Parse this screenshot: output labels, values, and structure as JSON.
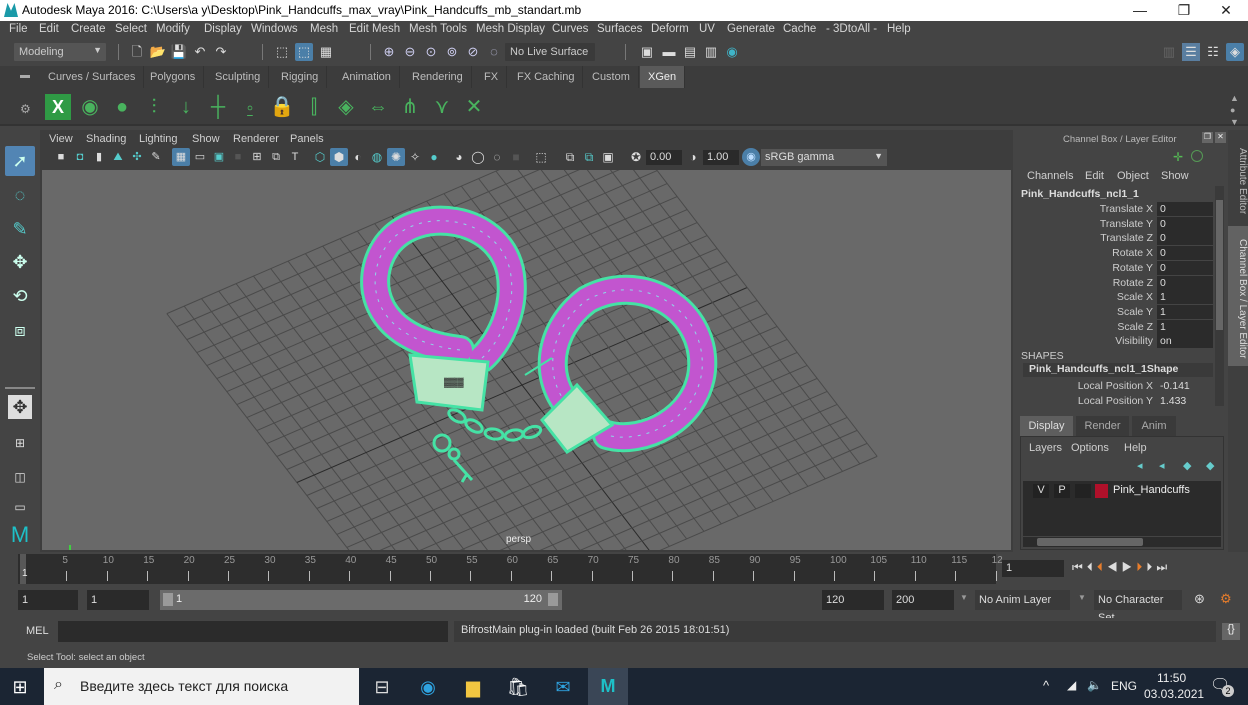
{
  "window": {
    "title": "Autodesk Maya 2016: C:\\Users\\a y\\Desktop\\Pink_Handcuffs_max_vray\\Pink_Handcuffs_mb_standart.mb",
    "minimize": "—",
    "maximize": "❐",
    "close": "✕"
  },
  "menubar": [
    "File",
    "Edit",
    "Create",
    "Select",
    "Modify",
    "Display",
    "Windows",
    "Mesh",
    "Edit Mesh",
    "Mesh Tools",
    "Mesh Display",
    "Curves",
    "Surfaces",
    "Deform",
    "UV",
    "Generate",
    "Cache",
    "- 3DtoAll -",
    "Help"
  ],
  "status_line": {
    "menu_set": "Modeling",
    "live_surface": "No Live Surface"
  },
  "shelf": {
    "tabs": [
      "Curves / Surfaces",
      "Polygons",
      "Sculpting",
      "Rigging",
      "Animation",
      "Rendering",
      "FX",
      "FX Caching",
      "Custom",
      "XGen"
    ],
    "active_tab": "XGen"
  },
  "panel": {
    "menus": [
      "View",
      "Shading",
      "Lighting",
      "Show",
      "Renderer",
      "Panels"
    ],
    "exposure": "0.00",
    "gamma": "1.00",
    "color_space": "sRGB gamma",
    "camera_label": "persp"
  },
  "channel_box": {
    "title": "Channel Box / Layer Editor",
    "menus": [
      "Channels",
      "Edit",
      "Object",
      "Show"
    ],
    "object_name": "Pink_Handcuffs_ncl1_1",
    "channels": [
      {
        "label": "Translate X",
        "value": "0"
      },
      {
        "label": "Translate Y",
        "value": "0"
      },
      {
        "label": "Translate Z",
        "value": "0"
      },
      {
        "label": "Rotate X",
        "value": "0"
      },
      {
        "label": "Rotate Y",
        "value": "0"
      },
      {
        "label": "Rotate Z",
        "value": "0"
      },
      {
        "label": "Scale X",
        "value": "1"
      },
      {
        "label": "Scale Y",
        "value": "1"
      },
      {
        "label": "Scale Z",
        "value": "1"
      },
      {
        "label": "Visibility",
        "value": "on"
      }
    ],
    "shapes_header": "SHAPES",
    "shape_name": "Pink_Handcuffs_ncl1_1Shape",
    "shape_channels": [
      {
        "label": "Local Position X",
        "value": "-0.141"
      },
      {
        "label": "Local Position Y",
        "value": "1.433"
      }
    ]
  },
  "layer_editor": {
    "tabs": [
      "Display",
      "Render",
      "Anim"
    ],
    "active_tab": "Display",
    "menus": [
      "Layers",
      "Options",
      "Help"
    ],
    "layers": [
      {
        "v": "V",
        "p": "P",
        "name": "Pink_Handcuffs",
        "color": "#b0102a"
      }
    ]
  },
  "side_tabs": [
    "Attribute Editor",
    "Channel Box / Layer Editor"
  ],
  "timeline": {
    "ticks": [
      "5",
      "10",
      "15",
      "20",
      "25",
      "30",
      "35",
      "40",
      "45",
      "50",
      "55",
      "60",
      "65",
      "70",
      "75",
      "80",
      "85",
      "90",
      "95",
      "100",
      "105",
      "110",
      "115",
      "12"
    ],
    "current_frame_marker": "1",
    "current_frame": "1"
  },
  "range": {
    "start": "1",
    "playback_start": "1",
    "slider_start": "1",
    "slider_end": "120",
    "playback_end": "120",
    "end": "200",
    "anim_layer": "No Anim Layer",
    "character_set": "No Character Set"
  },
  "command_line": {
    "label": "MEL",
    "result": "BifrostMain plug-in loaded (built Feb 26 2015 18:01:51)"
  },
  "help_line": "Select Tool: select an object",
  "taskbar": {
    "search_placeholder": "Введите здесь текст для поиска",
    "language": "ENG",
    "time": "11:50",
    "date": "03.03.2021",
    "notifications": "2"
  }
}
